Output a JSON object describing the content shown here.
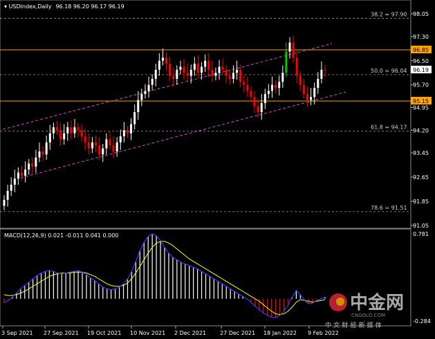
{
  "header": {
    "symbol": "USDIndex,Daily",
    "ohlc": "96.18 96.20 96.17 96.19"
  },
  "macd": {
    "label": "MACD(12,26,9) 0.021 -0.011 0.041 0.000",
    "axis_top": "0.781",
    "axis_bottom": "-0.284",
    "values": {
      "macd": 0.021,
      "signal": -0.011,
      "histogram": 0.041,
      "extra": 0.0
    }
  },
  "price_labels": {
    "resistance": "96.85",
    "support": "95.15",
    "current": "96.19"
  },
  "fib_levels": [
    {
      "label": "38.2 = 97.90",
      "value": 97.9
    },
    {
      "label": "50.0 = 96.04",
      "value": 96.04
    },
    {
      "label": "61.8 = 94.17",
      "value": 94.17
    },
    {
      "label": "78.6 = 91.51",
      "value": 91.51
    }
  ],
  "watermark": {
    "brand": "中金网",
    "domain": "CNGOLD.COM",
    "slogan": "中 文 财 经 新 媒 体"
  },
  "colors": {
    "bull": "#ffffff",
    "bear": "#ff0000",
    "bull_spike": "#00cc00",
    "horizontal_line": "#ffa500",
    "channel": "#cc55cc",
    "macd_line": "#3a3aff",
    "signal_line": "#ffff00"
  },
  "chart_data": {
    "type": "candlestick",
    "title": "USDIndex,Daily",
    "y_ticks": [
      98.05,
      97.3,
      96.5,
      95.7,
      94.95,
      94.2,
      93.45,
      92.65,
      91.85,
      91.05
    ],
    "ylim": [
      91.05,
      98.05
    ],
    "x_ticks": [
      "3 Sep 2021",
      "27 Sep 2021",
      "19 Oct 2021",
      "10 Nov 2021",
      "2 Dec 2021",
      "27 Dec 2021",
      "18 Jan 2022",
      "9 Feb 2022"
    ],
    "last_close": 96.19,
    "horizontal_lines": [
      96.85,
      95.15
    ],
    "series_close": [
      91.9,
      92.2,
      92.4,
      92.6,
      92.8,
      92.7,
      92.9,
      93.1,
      93.0,
      93.3,
      93.5,
      93.4,
      93.8,
      94.1,
      94.3,
      94.2,
      93.9,
      94.1,
      94.3,
      94.1,
      94.3,
      94.2,
      94.0,
      93.8,
      93.6,
      93.8,
      93.7,
      93.4,
      93.6,
      93.9,
      93.7,
      93.5,
      93.8,
      94.0,
      94.2,
      94.1,
      94.4,
      94.8,
      95.2,
      95.4,
      95.5,
      95.7,
      95.9,
      96.2,
      96.5,
      96.6,
      96.4,
      96.0,
      95.9,
      96.2,
      96.3,
      96.1,
      96.0,
      96.2,
      96.4,
      96.1,
      96.3,
      96.5,
      96.2,
      96.0,
      96.1,
      96.3,
      96.2,
      96.0,
      95.9,
      96.1,
      96.2,
      95.8,
      95.7,
      95.5,
      95.3,
      95.0,
      94.8,
      95.1,
      95.4,
      95.5,
      95.7,
      95.6,
      95.8,
      96.1,
      96.8,
      97.1,
      96.6,
      96.0,
      95.7,
      95.4,
      95.2,
      95.3,
      95.6,
      95.9,
      96.2,
      96.19
    ],
    "macd_series": [
      -0.05,
      -0.02,
      0.02,
      0.07,
      0.12,
      0.16,
      0.2,
      0.24,
      0.28,
      0.31,
      0.33,
      0.34,
      0.33,
      0.31,
      0.3,
      0.31,
      0.32,
      0.33,
      0.34,
      0.32,
      0.29,
      0.25,
      0.22,
      0.18,
      0.14,
      0.12,
      0.11,
      0.12,
      0.14,
      0.18,
      0.24,
      0.33,
      0.45,
      0.58,
      0.68,
      0.75,
      0.78,
      0.76,
      0.7,
      0.62,
      0.55,
      0.5,
      0.47,
      0.44,
      0.42,
      0.4,
      0.38,
      0.36,
      0.33,
      0.3,
      0.27,
      0.24,
      0.21,
      0.18,
      0.15,
      0.12,
      0.09,
      0.06,
      0.03,
      0.0,
      -0.04,
      -0.09,
      -0.13,
      -0.17,
      -0.2,
      -0.22,
      -0.23,
      -0.2,
      -0.15,
      -0.08,
      0.02,
      0.1,
      0.05,
      -0.02,
      -0.06,
      -0.05,
      -0.02,
      0.0,
      0.021
    ],
    "signal_series": [
      0.05,
      0.04,
      0.04,
      0.05,
      0.07,
      0.09,
      0.12,
      0.15,
      0.18,
      0.21,
      0.24,
      0.27,
      0.29,
      0.3,
      0.31,
      0.31,
      0.31,
      0.32,
      0.32,
      0.32,
      0.31,
      0.29,
      0.27,
      0.24,
      0.21,
      0.18,
      0.16,
      0.15,
      0.15,
      0.16,
      0.19,
      0.24,
      0.31,
      0.39,
      0.47,
      0.55,
      0.62,
      0.67,
      0.69,
      0.69,
      0.67,
      0.64,
      0.6,
      0.56,
      0.52,
      0.48,
      0.45,
      0.42,
      0.39,
      0.36,
      0.33,
      0.3,
      0.27,
      0.24,
      0.21,
      0.18,
      0.15,
      0.12,
      0.09,
      0.06,
      0.03,
      0.0,
      -0.03,
      -0.07,
      -0.11,
      -0.15,
      -0.18,
      -0.19,
      -0.18,
      -0.15,
      -0.1,
      -0.04,
      -0.01,
      -0.02,
      -0.03,
      -0.04,
      -0.03,
      -0.02,
      -0.011
    ]
  }
}
